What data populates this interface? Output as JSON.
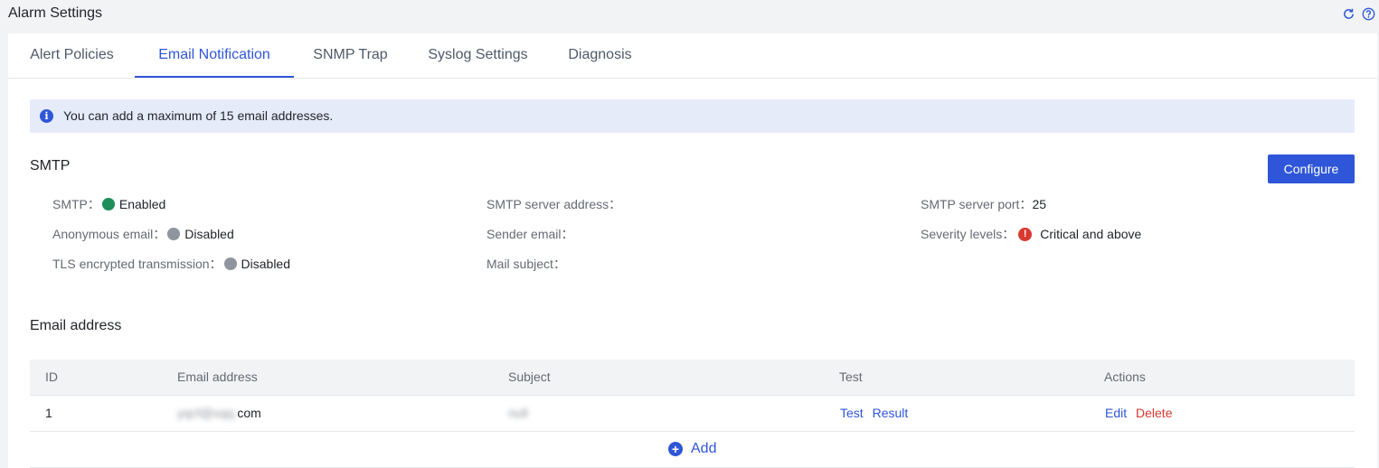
{
  "page": {
    "title": "Alarm Settings",
    "icons": [
      "refresh-icon",
      "help-icon"
    ]
  },
  "tabs": [
    {
      "label": "Alert Policies",
      "active": false
    },
    {
      "label": "Email Notification",
      "active": true
    },
    {
      "label": "SNMP Trap",
      "active": false
    },
    {
      "label": "Syslog Settings",
      "active": false
    },
    {
      "label": "Diagnosis",
      "active": false
    }
  ],
  "info": {
    "text": "You can add a maximum of 15 email addresses."
  },
  "smtp": {
    "title": "SMTP",
    "configure_label": "Configure",
    "fields": {
      "smtp_label": "SMTP：",
      "smtp_value": "Enabled",
      "anonymous_label": "Anonymous email：",
      "anonymous_value": "Disabled",
      "tls_label": "TLS encrypted transmission：",
      "tls_value": "Disabled",
      "server_address_label": "SMTP server address：",
      "server_address_value": "",
      "sender_label": "Sender email：",
      "sender_value": "",
      "subject_label": "Mail subject：",
      "subject_value": "",
      "port_label": "SMTP server port：",
      "port_value": "25",
      "severity_label": "Severity levels：",
      "severity_value": "Critical and above"
    }
  },
  "email": {
    "title": "Email address",
    "columns": [
      "ID",
      "Email address",
      "Subject",
      "Test",
      "Actions"
    ],
    "rows": [
      {
        "id": "1",
        "email_hidden": "yqcf@xqq.",
        "email_suffix": "com",
        "subject_hidden": "null",
        "test_label": "Test",
        "result_label": "Result",
        "edit_label": "Edit",
        "delete_label": "Delete"
      }
    ],
    "add_label": "Add"
  },
  "colors": {
    "accent": "#2f56d8",
    "enabled": "#1e8e5a",
    "disabled": "#8f959e",
    "critical": "#d83931",
    "info_bg": "#e6ebfa"
  }
}
